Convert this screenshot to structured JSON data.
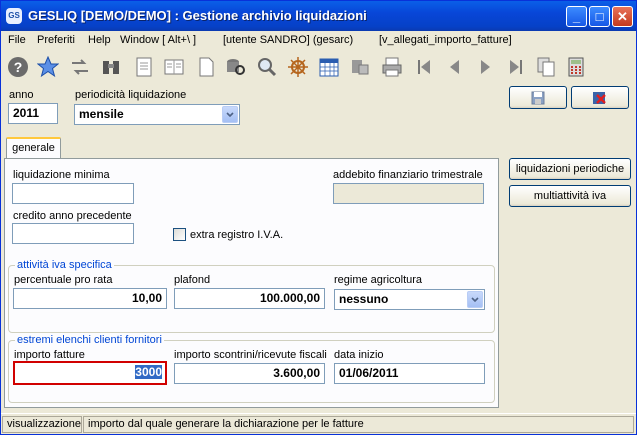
{
  "window": {
    "app_icon": "GS",
    "title": "GESLIQ [DEMO/DEMO] : Gestione archivio liquidazioni",
    "minimize": "_",
    "maximize": "□",
    "close": "✕"
  },
  "menu": {
    "items": [
      "File",
      "Preferiti",
      "Help",
      "Window [ Alt+\\ ]",
      "[utente SANDRO] (gesarc)",
      "[v_allegati_importo_fatture]"
    ]
  },
  "toolbar": {
    "icons": [
      "help-icon",
      "star-icon",
      "swap-icon",
      "binoculars-icon",
      "document-icon",
      "book-icon",
      "blank-page-icon",
      "search-database-icon",
      "magnifier-icon",
      "ship-wheel-icon",
      "calendar-icon",
      "database-tools-icon",
      "printer-icon",
      "first-record-icon",
      "previous-record-icon",
      "next-record-icon",
      "last-record-icon",
      "copy-icon",
      "calculator-icon"
    ]
  },
  "header": {
    "anno_label": "anno",
    "anno_value": "2011",
    "periodicita_label": "periodicità liquidazione",
    "periodicita_value": "mensile"
  },
  "tabs": [
    {
      "label": "generale",
      "active": true
    }
  ],
  "form": {
    "liquidazione_minima_label": "liquidazione minima",
    "liquidazione_minima_value": "",
    "addebito_label": "addebito finanziario trimestrale",
    "addebito_value": "",
    "credito_label": "credito anno precedente",
    "credito_value": "",
    "extra_registro_label": "extra registro I.V.A.",
    "extra_registro_checked": false,
    "attivita_group": "attività iva specifica",
    "pro_rata_label": "percentuale pro rata",
    "pro_rata_value": "10,00",
    "plafond_label": "plafond",
    "plafond_value": "100.000,00",
    "regime_label": "regime agricoltura",
    "regime_value": "nessuno",
    "estremi_group": "estremi elenchi clienti fornitori",
    "importo_fatture_label": "importo fatture",
    "importo_fatture_value": "3000",
    "scontrini_label": "importo scontrini/ricevute fiscali",
    "scontrini_value": "3.600,00",
    "data_inizio_label": "data inizio",
    "data_inizio_value": "01/06/2011"
  },
  "side_buttons": {
    "liquidazioni_periodiche": "liquidazioni periodiche",
    "multiattivita": "multiattività iva"
  },
  "status": {
    "mode": "visualizzazione",
    "message": "importo dal quale generare la dichiarazione per le fatture"
  },
  "colors": {
    "titlebar": "#0846d8",
    "focus_border": "#d10000",
    "group_legend": "#0046d5",
    "selection": "#316ac5"
  }
}
